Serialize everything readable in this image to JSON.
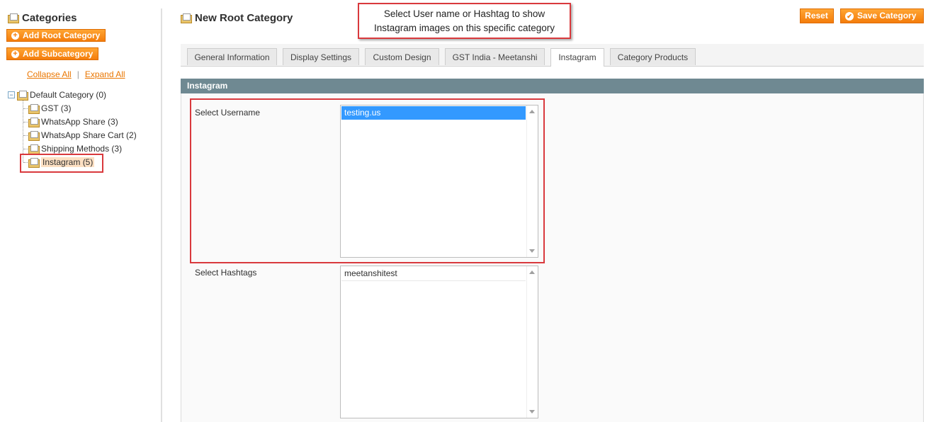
{
  "sidebar": {
    "title": "Categories",
    "add_root_label": "Add Root Category",
    "add_sub_label": "Add Subcategory",
    "collapse_all": "Collapse All",
    "separator": "|",
    "expand_all": "Expand All",
    "root": "Default Category (0)",
    "items": [
      {
        "label": "GST (3)"
      },
      {
        "label": "WhatsApp Share (3)"
      },
      {
        "label": "WhatsApp Share Cart (2)"
      },
      {
        "label": "Shipping Methods (3)"
      },
      {
        "label": "Instagram (5)"
      }
    ]
  },
  "header": {
    "title": "New Root Category",
    "reset_label": "Reset",
    "save_label": "Save Category"
  },
  "callout": {
    "text": "Select User name or Hashtag to show Instagram images on this specific category"
  },
  "tabs": [
    {
      "label": "General Information"
    },
    {
      "label": "Display Settings"
    },
    {
      "label": "Custom Design"
    },
    {
      "label": "GST India - Meetanshi"
    },
    {
      "label": "Instagram"
    },
    {
      "label": "Category Products"
    }
  ],
  "section": {
    "title": "Instagram",
    "username_label": "Select Username",
    "username_options": [
      "testing.us"
    ],
    "hashtags_label": "Select Hashtags",
    "hashtag_options": [
      "meetanshitest"
    ]
  },
  "colors": {
    "accent_orange": "#f47d0b",
    "section_header": "#6f8992",
    "highlight_red": "#d9393d",
    "selected_option": "#3399ff"
  }
}
